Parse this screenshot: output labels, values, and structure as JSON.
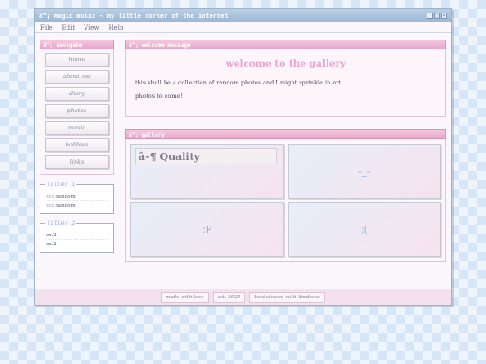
{
  "window": {
    "title": "â™¡ magic music ~ my little corner of the internet",
    "controls": [
      "_",
      "□",
      "×"
    ]
  },
  "menu": [
    "File",
    "Edit",
    "View",
    "Help"
  ],
  "sidebar": {
    "nav_title": "â™¡ navigate",
    "nav_items": [
      "home",
      "about me",
      "diary",
      "photos",
      "music",
      "hobbies",
      "links"
    ],
    "filler1": {
      "title": "filler 1",
      "rows": [
        {
          "key": "xxx:",
          "value": "random"
        },
        {
          "key": "xxx:",
          "value": "random"
        }
      ]
    },
    "filler2": {
      "title": "filler 2",
      "rows": [
        "ex.2",
        "ex.2"
      ]
    }
  },
  "welcome": {
    "header": "â™¡ welcome message",
    "title": "welcome to the gallery",
    "line1": "this shall be a collection of random photos and I might sprinkle in art",
    "line2": "photos to come!"
  },
  "gallery": {
    "header": "â™¡ gallery",
    "tiles": [
      "",
      "-_-",
      ":P",
      ":("
    ],
    "quality_label": "â–¶ Quality"
  },
  "footer": {
    "badges": [
      "made with love",
      "est. 2025",
      "best viewed with kindness"
    ]
  },
  "colors": {
    "accent_pink": "#e7a6c8",
    "accent_blue": "#9bb6d4",
    "title_pink": "#e8a3cc"
  }
}
